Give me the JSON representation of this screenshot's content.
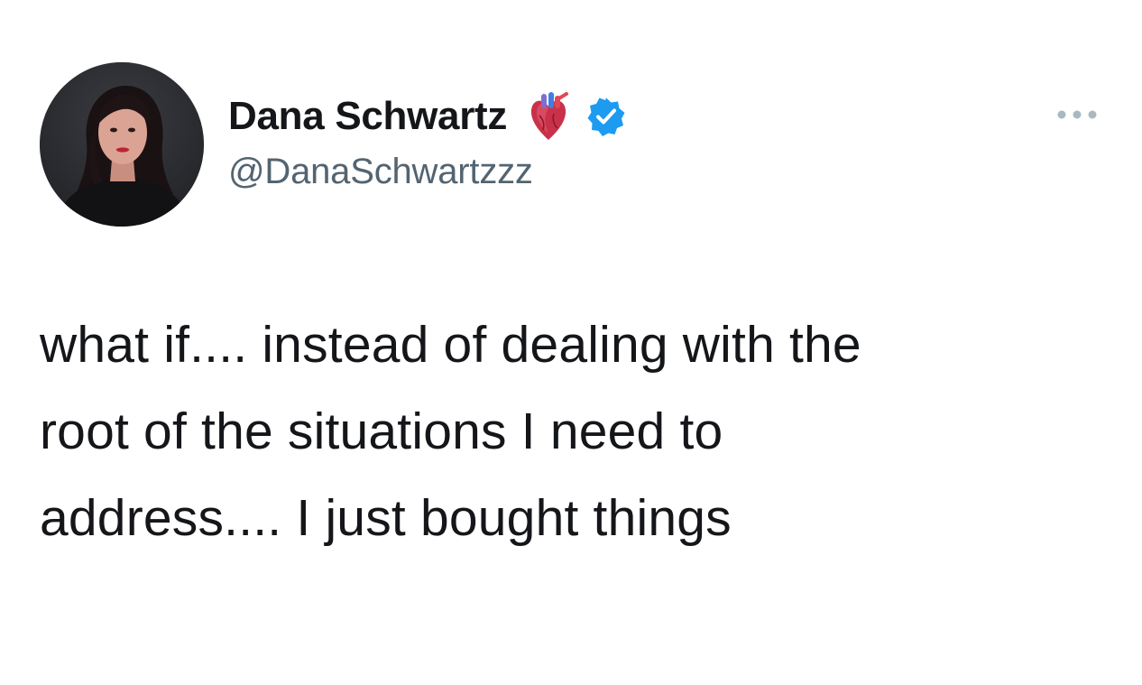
{
  "tweet": {
    "author": {
      "display_name": "Dana Schwartz",
      "handle": "@DanaSchwartzzz",
      "name_emoji": "anatomical-heart-emoji",
      "verified": true,
      "avatar": "profile-photo"
    },
    "text": "what if.... instead of dealing with the\nroot of the situations I need to\naddress.... I  just bought things",
    "more_icon": "ellipsis-icon"
  },
  "colors": {
    "text_primary": "#141619",
    "text_secondary": "#536471",
    "verified_blue": "#1d9bf0",
    "background": "#ffffff"
  }
}
